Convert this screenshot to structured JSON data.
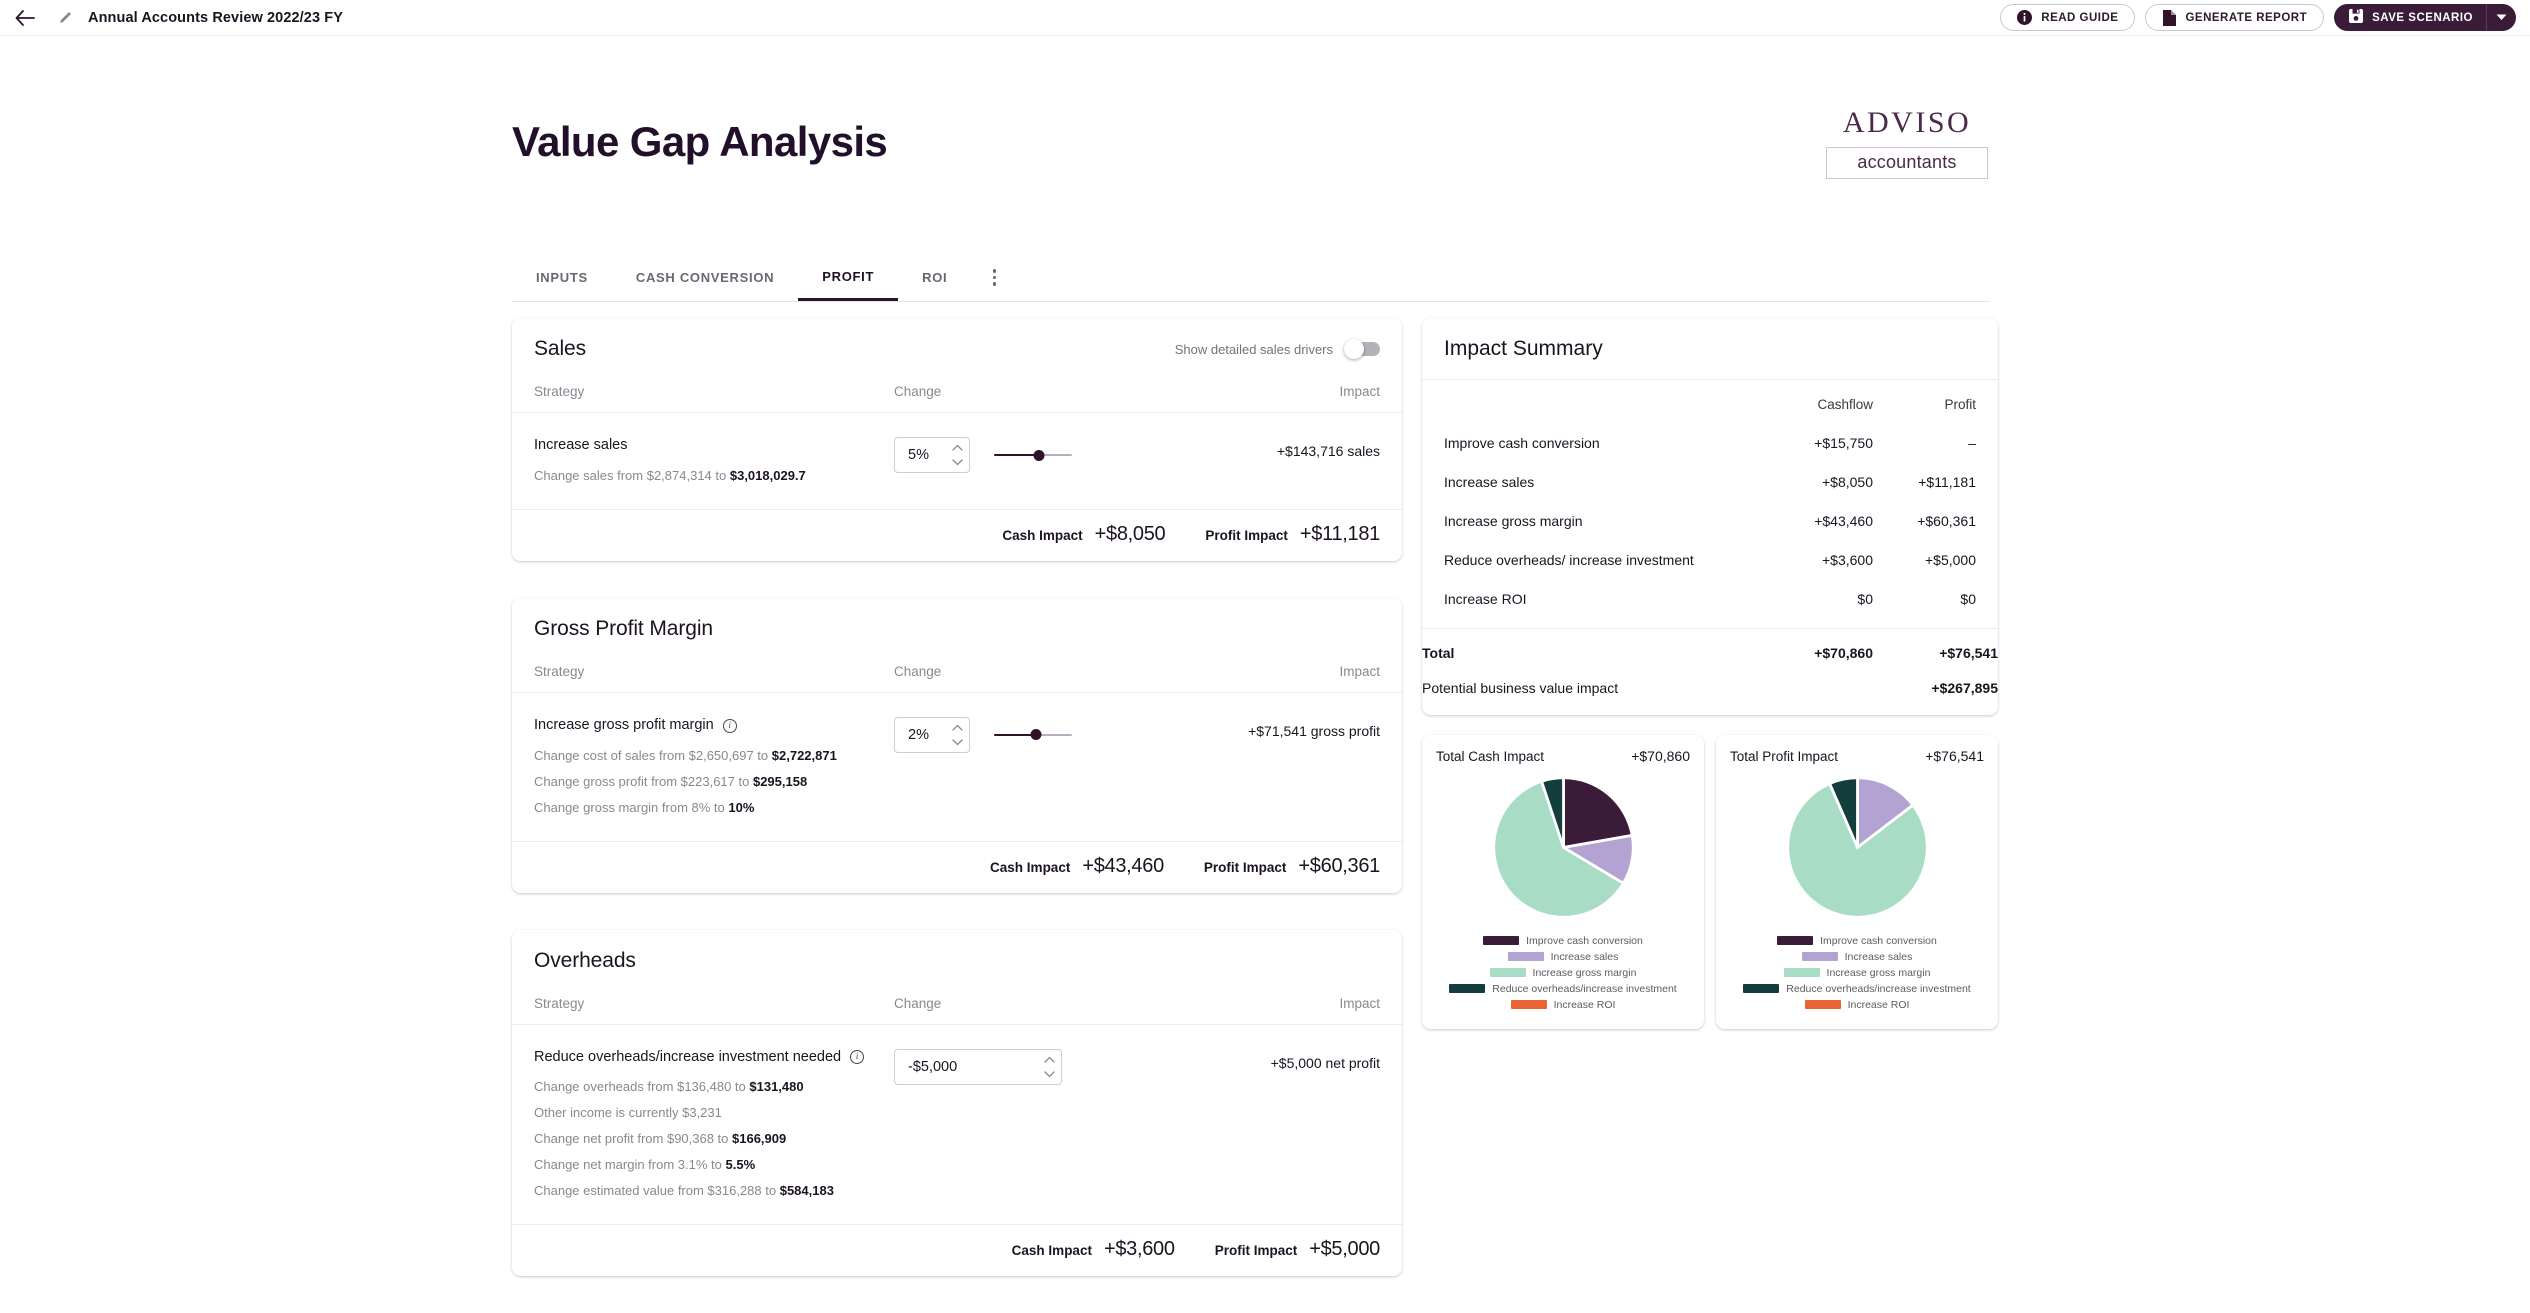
{
  "topbar": {
    "back_icon": "arrow-left-icon",
    "edit_icon": "pencil-icon",
    "scenario_title": "Annual Accounts Review 2022/23 FY",
    "read_guide_label": "READ GUIDE",
    "generate_report_label": "GENERATE REPORT",
    "save_scenario_label": "SAVE SCENARIO"
  },
  "header": {
    "page_title": "Value Gap Analysis",
    "logo_word": "ADVISO",
    "logo_sub": "accountants"
  },
  "tabs": {
    "items": [
      {
        "label": "INPUTS",
        "active": false
      },
      {
        "label": "CASH CONVERSION",
        "active": false
      },
      {
        "label": "PROFIT",
        "active": true
      },
      {
        "label": "ROI",
        "active": false
      }
    ],
    "more_label": "more-options"
  },
  "columns": {
    "strategy": "Strategy",
    "change": "Change",
    "impact": "Impact"
  },
  "footer_labels": {
    "cash": "Cash Impact",
    "profit": "Profit Impact"
  },
  "cards": [
    {
      "title": "Sales",
      "toggle_label": "Show detailed sales drivers",
      "toggle_on": false,
      "strategy": "Increase sales",
      "value": "5%",
      "slider_pct": 58,
      "impact": "+$143,716 sales",
      "sub_lines": [
        {
          "pre": "Change sales from $2,874,314 to ",
          "strong": "$3,018,029.7"
        }
      ],
      "cash_impact": "+$8,050",
      "profit_impact": "+$11,181"
    },
    {
      "title": "Gross Profit Margin",
      "strategy": "Increase gross profit margin",
      "has_info": true,
      "value": "2%",
      "slider_pct": 54,
      "impact": "+$71,541 gross profit",
      "sub_lines": [
        {
          "pre": "Change cost of sales from $2,650,697 to ",
          "strong": "$2,722,871"
        },
        {
          "pre": "Change gross profit from $223,617 to ",
          "strong": "$295,158"
        },
        {
          "pre": "Change gross margin from 8% to ",
          "strong": "10%"
        }
      ],
      "cash_impact": "+$43,460",
      "profit_impact": "+$60,361"
    },
    {
      "title": "Overheads",
      "strategy": "Reduce overheads/increase investment needed",
      "has_info": true,
      "value": "-$5,000",
      "wide_input": true,
      "impact": "+$5,000 net profit",
      "sub_lines": [
        {
          "pre": "Change overheads from $136,480 to ",
          "strong": "$131,480"
        },
        {
          "pre": "Other income is currently $3,231",
          "strong": ""
        },
        {
          "pre": "Change net profit from $90,368 to ",
          "strong": "$166,909"
        },
        {
          "pre": "Change net margin from 3.1% to ",
          "strong": "5.5%"
        },
        {
          "pre": "Change estimated value from $316,288 to ",
          "strong": "$584,183"
        }
      ],
      "cash_impact": "+$3,600",
      "profit_impact": "+$5,000"
    }
  ],
  "summary": {
    "title": "Impact Summary",
    "col_cashflow": "Cashflow",
    "col_profit": "Profit",
    "rows": [
      {
        "label": "Improve cash conversion",
        "cashflow": "+$15,750",
        "profit": "–"
      },
      {
        "label": "Increase sales",
        "cashflow": "+$8,050",
        "profit": "+$11,181"
      },
      {
        "label": "Increase gross margin",
        "cashflow": "+$43,460",
        "profit": "+$60,361"
      },
      {
        "label": "Reduce overheads/ increase investment",
        "cashflow": "+$3,600",
        "profit": "+$5,000"
      },
      {
        "label": "Increase ROI",
        "cashflow": "$0",
        "profit": "$0"
      }
    ],
    "total_label": "Total",
    "total_cashflow": "+$70,860",
    "total_profit": "+$76,541",
    "pbv_label": "Potential business value impact",
    "pbv_value": "+$267,895"
  },
  "colors": {
    "improve_cash_conversion": "#3b1c38",
    "increase_sales": "#b3a3d2",
    "increase_gross_margin": "#a9dcc5",
    "reduce_overheads": "#143d3e",
    "increase_roi": "#e86432",
    "brand_dark": "#3a1c38"
  },
  "chart_data": [
    {
      "type": "pie",
      "title": "Total Cash Impact",
      "total_label": "+$70,860",
      "total": 70860,
      "categories": [
        "Improve cash conversion",
        "Increase sales",
        "Increase gross margin",
        "Reduce overheads/increase investment",
        "Increase ROI"
      ],
      "values": [
        15750,
        8050,
        43460,
        3600,
        0
      ],
      "colors": [
        "#3b1c38",
        "#b3a3d2",
        "#a9dcc5",
        "#143d3e",
        "#e86432"
      ],
      "legend": "bottom"
    },
    {
      "type": "pie",
      "title": "Total Profit Impact",
      "total_label": "+$76,541",
      "total": 76541,
      "categories": [
        "Improve cash conversion",
        "Increase sales",
        "Increase gross margin",
        "Reduce overheads/increase investment",
        "Increase ROI"
      ],
      "values": [
        0,
        11181,
        60361,
        5000,
        0
      ],
      "colors": [
        "#3b1c38",
        "#b3a3d2",
        "#a9dcc5",
        "#143d3e",
        "#e86432"
      ],
      "legend": "bottom"
    }
  ]
}
